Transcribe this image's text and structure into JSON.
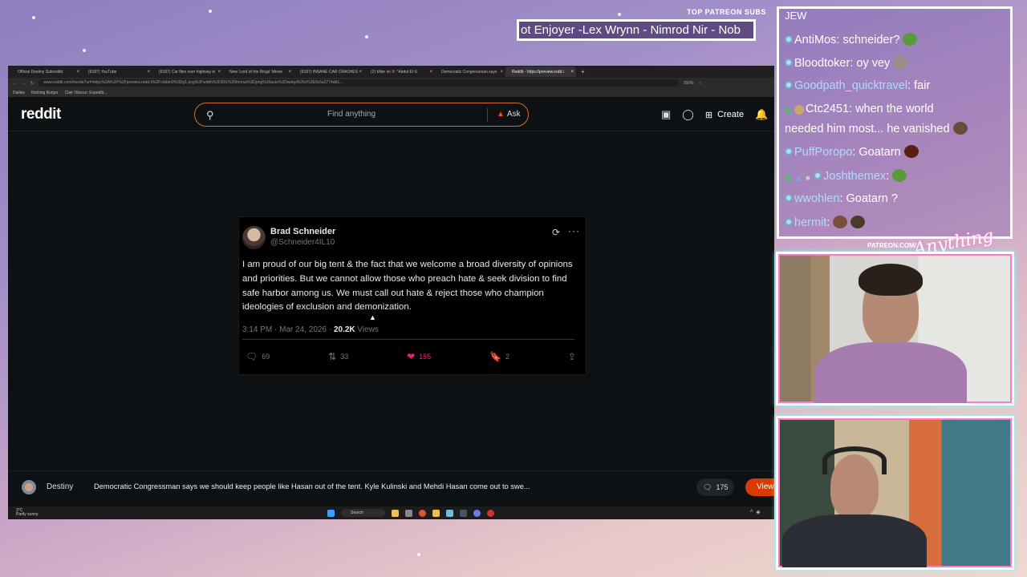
{
  "overlay": {
    "top_patreon_label": "TOP PATREON SUBS",
    "ticker_text": "ot Enjoyer -Lex Wrynn - Nimrod Nir - Nob",
    "patreon_url": "PATREON.COM/",
    "brand_text": "Anything Else?"
  },
  "browser": {
    "tabs": [
      {
        "label": "Official Destiny Subreddit"
      },
      {
        "label": "(6187) YouTube"
      },
      {
        "label": "(6187) Car flies over highway in"
      },
      {
        "label": "New 'Lord of the Rings' Movie"
      },
      {
        "label": "(6187) INSANE CAR CRASHES"
      },
      {
        "label": "(2) Mike on X: \"Abdul El-S"
      },
      {
        "label": "Democratic Congressman says"
      },
      {
        "label": "Reddit - https://preview.redd.i"
      }
    ],
    "url": "www.reddit.com/media?url=https%3A%2F%2Fpreview.redd.it%2Fvdddn0%3Dg1.png%3Fwidth%3D591%26format%3Dpng%26auto%3Dwebp%26s%3E0c5a2774dd1...",
    "zoom": "150%",
    "bookmarks": [
      "Dailies",
      "Nothing Burger",
      "Clair Obscur: Expediti..."
    ]
  },
  "reddit": {
    "logo": "reddit",
    "search_placeholder": "Find anything",
    "ask_label": "Ask",
    "create_label": "Create"
  },
  "tweet": {
    "name": "Brad Schneider",
    "handle": "@Schneider4IL10",
    "body": "I am proud of our big tent & the fact that we welcome a broad diversity of opinions and priorities. But we cannot allow those who preach hate & seek division to find safe harbor among us. We must call out hate & reject those who champion ideologies of exclusion and demonization.",
    "time": "3:14 PM · Mar 24, 2026 · ",
    "views_count": "20.2K",
    "views_label": " Views",
    "replies": "69",
    "reposts": "33",
    "likes": "155",
    "bookmarks": "2"
  },
  "post": {
    "user": "Destiny",
    "title": "Democratic Congressman says we should keep people like Hasan out of the tent. Kyle Kulinski and Mehdi Hasan come out to swe...",
    "comments": "175",
    "view_label": "View"
  },
  "taskbar": {
    "temp": "3°C",
    "weather": "Partly sunny",
    "search": "Search"
  },
  "chat": {
    "header": "JEW",
    "messages": [
      {
        "user": "AntiMos",
        "text": ": schneider?"
      },
      {
        "user": "Bloodtoker",
        "text": ": oy vey"
      },
      {
        "user": "Goodpath_quicktravel",
        "text": ": fair"
      },
      {
        "user": "Ctc2451",
        "text": ": when the world"
      },
      {
        "user": "",
        "text": "needed him most... he vanished"
      },
      {
        "user": "PuffPoropo",
        "text": ": Goatarn"
      },
      {
        "user": "Joshthemex",
        "text": ":"
      },
      {
        "user": "wwohlen",
        "text": ": Goatarn ?"
      },
      {
        "user": "hermit",
        "text": ":"
      }
    ]
  },
  "colors": {
    "reddit_orange": "#ff4500",
    "like_pink": "#f91880",
    "chat_user_blue": "#aedcff"
  }
}
